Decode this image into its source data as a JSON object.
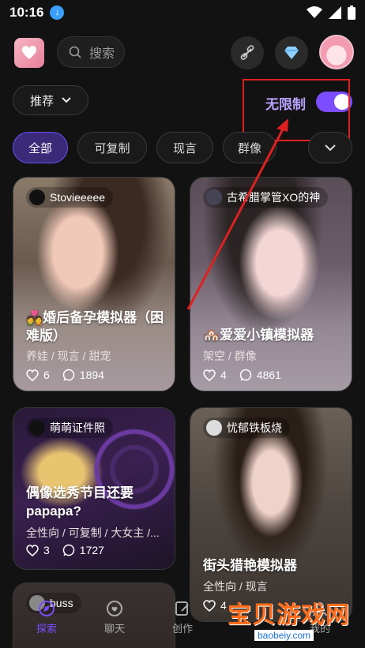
{
  "status": {
    "time": "10:16"
  },
  "header": {
    "search_placeholder": "搜索"
  },
  "filters": {
    "sort_label": "推荐",
    "unlimited_label": "无限制",
    "unlimited_on": true
  },
  "chips": [
    {
      "label": "全部",
      "active": true
    },
    {
      "label": "可复制",
      "active": false
    },
    {
      "label": "现言",
      "active": false
    },
    {
      "label": "群像",
      "active": false
    }
  ],
  "cards": [
    {
      "author": "Stovieeeee",
      "title_line1": "💑婚后备孕模拟器（困",
      "title_line2": "难版）",
      "tags": "养娃 / 现言 / 甜宠",
      "likes": "6",
      "comments": "1894"
    },
    {
      "author": "古希腊掌管XO的神",
      "title_line1": "🏘️爱爱小镇模拟器",
      "title_line2": "",
      "tags": "架空 / 群像",
      "likes": "4",
      "comments": "4861"
    },
    {
      "author": "萌萌证件照",
      "title_line1": "偶像选秀节目还要",
      "title_line2": "papapa?",
      "tags": "全性向 / 可复制 / 大女主 /...",
      "likes": "3",
      "comments": "1727"
    },
    {
      "author": "忧郁铁板烧",
      "title_line1": "街头猎艳模拟器",
      "title_line2": "",
      "tags": "全性向 / 现言",
      "likes": "4",
      "comments": ""
    },
    {
      "author": "buss"
    }
  ],
  "nav": [
    {
      "label": "探索",
      "active": true
    },
    {
      "label": "聊天",
      "active": false
    },
    {
      "label": "创作",
      "active": false
    },
    {
      "label": "我的",
      "active": false
    }
  ],
  "watermark": {
    "text": "宝贝游戏网",
    "url": "baobeiy.com"
  },
  "colors": {
    "accent": "#7c4dff",
    "annotation": "#e02020",
    "watermark": "#ff6b1a"
  }
}
